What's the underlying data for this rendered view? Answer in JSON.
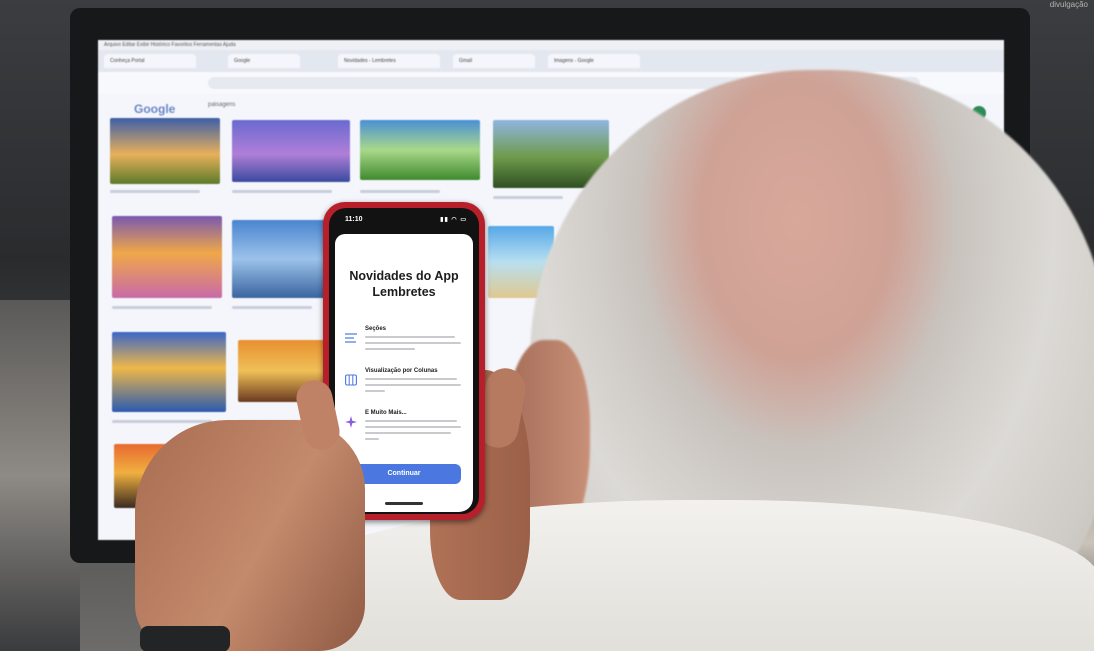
{
  "credit": "divulgação",
  "browser": {
    "menu": "Arquivo  Editar  Exibir  Histórico  Favoritos  Ferramentas  Ajuda",
    "tabs": [
      "Conheça Portal",
      "Google",
      "Novidades - Lembretes",
      "Gmail",
      "Imagens - Google"
    ],
    "logo": "Google",
    "search": "paisagens"
  },
  "phone": {
    "time": "11:10",
    "status_icons": "▮▮ ◠ ▭",
    "title": "Novidades do App Lembretes",
    "features": [
      {
        "icon": "sections-icon",
        "title": "Seções"
      },
      {
        "icon": "columns-icon",
        "title": "Visualização por Colunas"
      },
      {
        "icon": "sparkle-icon",
        "title": "E Muito Mais..."
      }
    ],
    "button": "Continuar"
  },
  "colors": {
    "phone_case": "#b7202b",
    "accent": "#4a78e0"
  }
}
